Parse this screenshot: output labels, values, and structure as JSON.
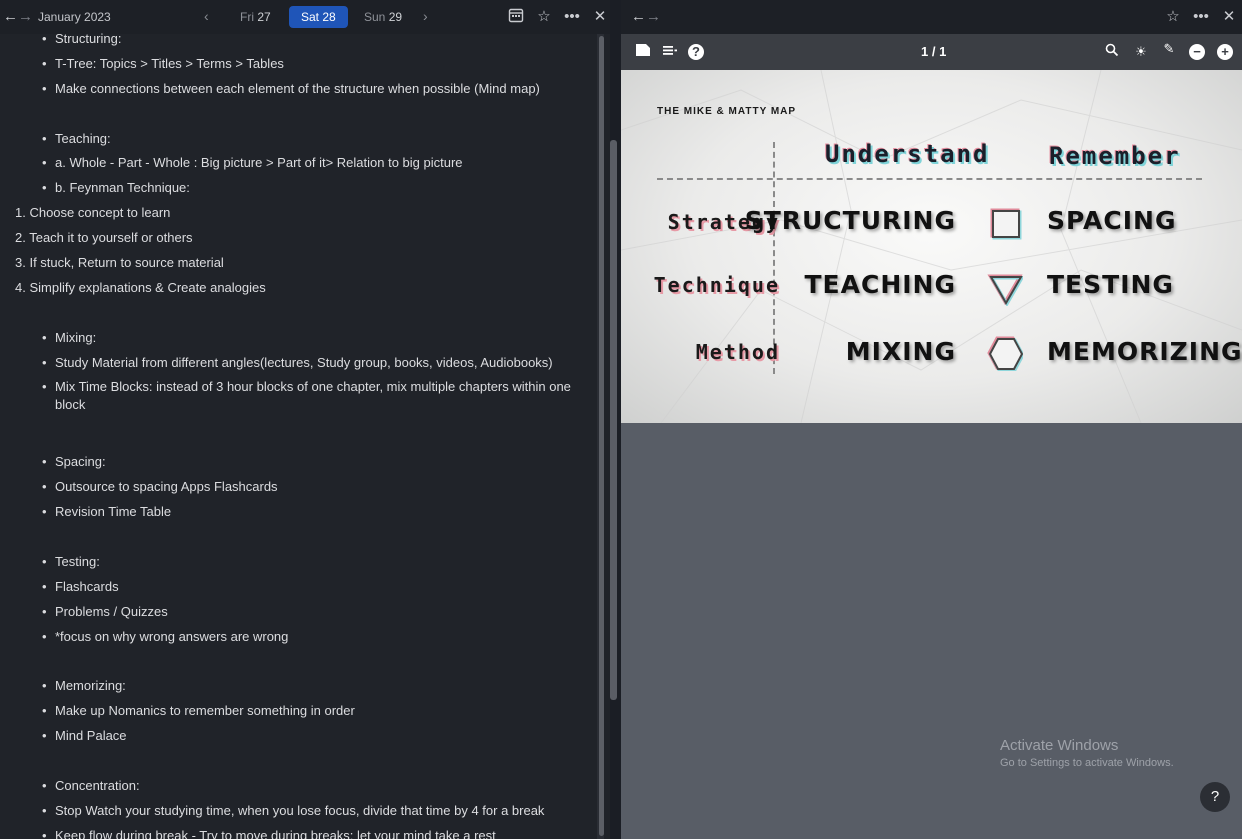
{
  "left": {
    "month_label": "January 2023",
    "days": [
      {
        "name": "Fri",
        "num": "27"
      },
      {
        "name": "Sat",
        "num": "28"
      },
      {
        "name": "Sun",
        "num": "29"
      }
    ],
    "notes": [
      {
        "text": "Structuring:"
      },
      {
        "text": "T-Tree: Topics > Titles > Terms > Tables"
      },
      {
        "text": "Make connections between each element of the structure when possible (Mind map)"
      },
      {
        "text": "Teaching:"
      },
      {
        "text": "a. Whole - Part - Whole : Big picture > Part of it> Relation to big picture"
      },
      {
        "text": "b. Feynman Technique:"
      },
      {
        "text": "1. Choose concept to learn"
      },
      {
        "text": "2. Teach it to yourself or others"
      },
      {
        "text": "3. If stuck, Return to source material"
      },
      {
        "text": "4. Simplify explanations & Create analogies"
      },
      {
        "text": "Mixing:"
      },
      {
        "text": "Study Material from different angles(lectures, Study group, books, videos, Audiobooks)"
      },
      {
        "text": "Mix Time Blocks: instead of 3 hour blocks of one chapter, mix multiple chapters within one block"
      },
      {
        "text": "Spacing:"
      },
      {
        "text": "Outsource to spacing Apps Flashcards"
      },
      {
        "text": "Revision Time Table"
      },
      {
        "text": "Testing:"
      },
      {
        "text": "Flashcards"
      },
      {
        "text": "Problems / Quizzes"
      },
      {
        "text": "*focus on why wrong answers are wrong"
      },
      {
        "text": "Memorizing:"
      },
      {
        "text": "Make up Nomanics to remember something in order"
      },
      {
        "text": "Mind Palace"
      },
      {
        "text": "Concentration:"
      },
      {
        "text": "Stop Watch your studying time, when you lose focus, divide that time by 4 for a break"
      },
      {
        "text": "Keep flow during break - Try to move during breaks: let your mind take a rest"
      }
    ]
  },
  "right": {
    "page_count": "1 / 1",
    "map": {
      "title": "THE MIKE & MATTY MAP",
      "columns": [
        "Understand",
        "Remember"
      ],
      "rows": [
        {
          "label": "Strategy",
          "left": "STRUCTURING",
          "right": "SPACING"
        },
        {
          "label": "Technique",
          "left": "TEACHING",
          "right": "TESTING"
        },
        {
          "label": "Method",
          "left": "MIXING",
          "right": "MEMORIZING"
        }
      ]
    },
    "watermark": {
      "title": "Activate Windows",
      "subtitle": "Go to Settings to activate Windows."
    },
    "help_label": "?"
  }
}
